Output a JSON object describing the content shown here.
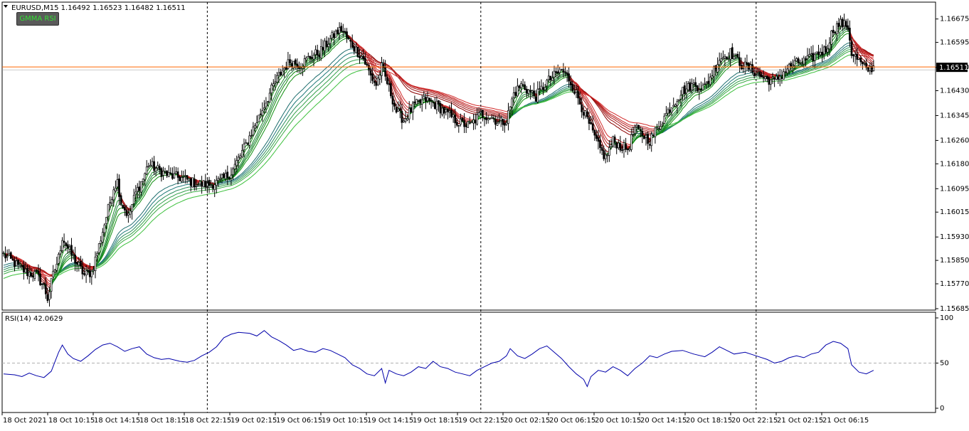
{
  "header": {
    "symbol_line": "EURUSD,M15  1.16492 1.16523 1.16482 1.16511",
    "indicator_button": "GMMA RSI"
  },
  "colors": {
    "bull_candle": "#000000",
    "bear_candle": "#000000",
    "gmma_short_palette": [
      "#0d8a0d",
      "#118f11",
      "#1b8a2a",
      "#217f40"
    ],
    "gmma_long_palette": [
      "#1e6e6e",
      "#1e7878",
      "#2a8c5a",
      "#33a04a",
      "#3aaa44",
      "#3dc03d"
    ],
    "gmma_bear_palette": [
      "#8b0000",
      "#9a0a0a",
      "#a81515",
      "#b51e1e",
      "#c42525",
      "#d22b2b"
    ],
    "price_line": "#ff6600",
    "rsi_line": "#0000aa",
    "grid_separator": "#000000"
  },
  "chart_data": [
    {
      "type": "candlestick",
      "title": "EURUSD,M15",
      "ohlc_latest": {
        "open": 1.16492,
        "high": 1.16523,
        "low": 1.16482,
        "close": 1.16511
      },
      "price_axis": {
        "ticks": [
          "1.16675",
          "1.16595",
          "1.16510",
          "1.16430",
          "1.16345",
          "1.16260",
          "1.16180",
          "1.16095",
          "1.16015",
          "1.15930",
          "1.15850",
          "1.15770",
          "1.15685"
        ],
        "current_price_label": "1.16511",
        "range": [
          1.15685,
          1.16718
        ]
      },
      "time_axis": {
        "labels": [
          "18 Oct 2021",
          "18 Oct 10:15",
          "18 Oct 14:15",
          "18 Oct 18:15",
          "18 Oct 22:15",
          "19 Oct 02:15",
          "19 Oct 06:15",
          "19 Oct 10:15",
          "19 Oct 14:15",
          "19 Oct 18:15",
          "19 Oct 22:15",
          "20 Oct 02:15",
          "20 Oct 06:15",
          "20 Oct 10:15",
          "20 Oct 14:15",
          "20 Oct 18:15",
          "20 Oct 22:15",
          "21 Oct 02:15",
          "21 Oct 06:15"
        ]
      },
      "close_path": [
        [
          0,
          1.1587
        ],
        [
          6,
          1.1584
        ],
        [
          12,
          1.1581
        ],
        [
          18,
          1.158
        ],
        [
          22,
          1.1576
        ],
        [
          24,
          1.1572
        ],
        [
          27,
          1.158
        ],
        [
          30,
          1.1586
        ],
        [
          32,
          1.1593
        ],
        [
          36,
          1.1588
        ],
        [
          40,
          1.1584
        ],
        [
          44,
          1.158
        ],
        [
          48,
          1.1581
        ],
        [
          52,
          1.159
        ],
        [
          56,
          1.16
        ],
        [
          60,
          1.161
        ],
        [
          62,
          1.1612
        ],
        [
          64,
          1.1605
        ],
        [
          68,
          1.16
        ],
        [
          72,
          1.1608
        ],
        [
          76,
          1.1613
        ],
        [
          79,
          1.1618
        ],
        [
          84,
          1.1616
        ],
        [
          90,
          1.1614
        ],
        [
          98,
          1.1613
        ],
        [
          106,
          1.1611
        ],
        [
          112,
          1.1611
        ],
        [
          118,
          1.1612
        ],
        [
          124,
          1.1615
        ],
        [
          130,
          1.1622
        ],
        [
          136,
          1.163
        ],
        [
          142,
          1.1638
        ],
        [
          148,
          1.1646
        ],
        [
          152,
          1.165
        ],
        [
          156,
          1.1653
        ],
        [
          162,
          1.1652
        ],
        [
          168,
          1.1655
        ],
        [
          172,
          1.1656
        ],
        [
          176,
          1.1659
        ],
        [
          180,
          1.1662
        ],
        [
          184,
          1.1664
        ],
        [
          188,
          1.166
        ],
        [
          192,
          1.1657
        ],
        [
          196,
          1.1654
        ],
        [
          200,
          1.1648
        ],
        [
          203,
          1.1645
        ],
        [
          206,
          1.1651
        ],
        [
          210,
          1.1644
        ],
        [
          214,
          1.1636
        ],
        [
          218,
          1.1633
        ],
        [
          224,
          1.1638
        ],
        [
          230,
          1.164
        ],
        [
          236,
          1.1638
        ],
        [
          242,
          1.1635
        ],
        [
          248,
          1.1632
        ],
        [
          254,
          1.1631
        ],
        [
          260,
          1.1635
        ],
        [
          266,
          1.1634
        ],
        [
          270,
          1.1632
        ],
        [
          274,
          1.1633
        ],
        [
          278,
          1.1642
        ],
        [
          282,
          1.1645
        ],
        [
          286,
          1.1643
        ],
        [
          290,
          1.1641
        ],
        [
          296,
          1.1646
        ],
        [
          300,
          1.1648
        ],
        [
          304,
          1.165
        ],
        [
          308,
          1.1647
        ],
        [
          312,
          1.1642
        ],
        [
          316,
          1.1636
        ],
        [
          320,
          1.163
        ],
        [
          324,
          1.1624
        ],
        [
          328,
          1.162
        ],
        [
          332,
          1.1626
        ],
        [
          336,
          1.1624
        ],
        [
          340,
          1.1623
        ],
        [
          344,
          1.163
        ],
        [
          348,
          1.1628
        ],
        [
          352,
          1.1626
        ],
        [
          356,
          1.163
        ],
        [
          360,
          1.1634
        ],
        [
          364,
          1.1638
        ],
        [
          370,
          1.1643
        ],
        [
          376,
          1.1645
        ],
        [
          382,
          1.1644
        ],
        [
          386,
          1.1649
        ],
        [
          390,
          1.1654
        ],
        [
          396,
          1.1656
        ],
        [
          402,
          1.1652
        ],
        [
          408,
          1.165
        ],
        [
          412,
          1.1648
        ],
        [
          416,
          1.1647
        ],
        [
          420,
          1.1646
        ],
        [
          426,
          1.165
        ],
        [
          430,
          1.1652
        ],
        [
          436,
          1.1653
        ],
        [
          440,
          1.1654
        ],
        [
          444,
          1.1656
        ],
        [
          448,
          1.1657
        ],
        [
          452,
          1.1664
        ],
        [
          456,
          1.1666
        ],
        [
          460,
          1.1665
        ],
        [
          462,
          1.1656
        ],
        [
          466,
          1.1653
        ],
        [
          470,
          1.165
        ],
        [
          474,
          1.16511
        ]
      ]
    },
    {
      "type": "line",
      "title": "RSI(14) 42.0629",
      "y_axis": {
        "ticks": [
          "100",
          "50",
          "0"
        ],
        "range": [
          0,
          100
        ],
        "level_line": 50
      },
      "series": [
        {
          "name": "RSI(14)",
          "points": [
            [
              0,
              38
            ],
            [
              6,
              37
            ],
            [
              10,
              35
            ],
            [
              14,
              39
            ],
            [
              18,
              36
            ],
            [
              22,
              34
            ],
            [
              26,
              41
            ],
            [
              30,
              62
            ],
            [
              32,
              70
            ],
            [
              35,
              60
            ],
            [
              38,
              55
            ],
            [
              42,
              52
            ],
            [
              46,
              58
            ],
            [
              50,
              65
            ],
            [
              54,
              70
            ],
            [
              58,
              72
            ],
            [
              62,
              68
            ],
            [
              66,
              63
            ],
            [
              70,
              66
            ],
            [
              74,
              68
            ],
            [
              78,
              60
            ],
            [
              82,
              56
            ],
            [
              86,
              54
            ],
            [
              90,
              55
            ],
            [
              96,
              52
            ],
            [
              100,
              51
            ],
            [
              104,
              53
            ],
            [
              108,
              58
            ],
            [
              112,
              62
            ],
            [
              116,
              68
            ],
            [
              120,
              78
            ],
            [
              124,
              82
            ],
            [
              128,
              84
            ],
            [
              134,
              83
            ],
            [
              138,
              80
            ],
            [
              142,
              86
            ],
            [
              146,
              79
            ],
            [
              150,
              75
            ],
            [
              154,
              70
            ],
            [
              158,
              64
            ],
            [
              162,
              66
            ],
            [
              166,
              63
            ],
            [
              170,
              62
            ],
            [
              174,
              66
            ],
            [
              178,
              64
            ],
            [
              182,
              60
            ],
            [
              186,
              56
            ],
            [
              190,
              48
            ],
            [
              194,
              44
            ],
            [
              198,
              38
            ],
            [
              202,
              36
            ],
            [
              206,
              44
            ],
            [
              208,
              28
            ],
            [
              210,
              42
            ],
            [
              214,
              38
            ],
            [
              218,
              36
            ],
            [
              222,
              40
            ],
            [
              226,
              46
            ],
            [
              230,
              44
            ],
            [
              234,
              52
            ],
            [
              238,
              46
            ],
            [
              242,
              44
            ],
            [
              246,
              40
            ],
            [
              250,
              38
            ],
            [
              254,
              36
            ],
            [
              258,
              42
            ],
            [
              262,
              46
            ],
            [
              266,
              50
            ],
            [
              270,
              52
            ],
            [
              274,
              58
            ],
            [
              276,
              66
            ],
            [
              280,
              58
            ],
            [
              284,
              55
            ],
            [
              288,
              60
            ],
            [
              292,
              66
            ],
            [
              296,
              69
            ],
            [
              300,
              62
            ],
            [
              304,
              55
            ],
            [
              308,
              46
            ],
            [
              312,
              38
            ],
            [
              316,
              32
            ],
            [
              318,
              24
            ],
            [
              320,
              35
            ],
            [
              324,
              42
            ],
            [
              328,
              40
            ],
            [
              332,
              46
            ],
            [
              336,
              42
            ],
            [
              340,
              36
            ],
            [
              344,
              44
            ],
            [
              348,
              50
            ],
            [
              352,
              58
            ],
            [
              356,
              56
            ],
            [
              360,
              60
            ],
            [
              364,
              63
            ],
            [
              370,
              64
            ],
            [
              376,
              60
            ],
            [
              382,
              57
            ],
            [
              386,
              62
            ],
            [
              390,
              68
            ],
            [
              394,
              64
            ],
            [
              398,
              60
            ],
            [
              404,
              62
            ],
            [
              410,
              58
            ],
            [
              416,
              54
            ],
            [
              420,
              50
            ],
            [
              424,
              52
            ],
            [
              428,
              56
            ],
            [
              432,
              58
            ],
            [
              436,
              56
            ],
            [
              440,
              60
            ],
            [
              444,
              62
            ],
            [
              448,
              70
            ],
            [
              452,
              74
            ],
            [
              456,
              72
            ],
            [
              460,
              66
            ],
            [
              462,
              48
            ],
            [
              466,
              40
            ],
            [
              470,
              38
            ],
            [
              474,
              42
            ]
          ]
        }
      ]
    }
  ]
}
